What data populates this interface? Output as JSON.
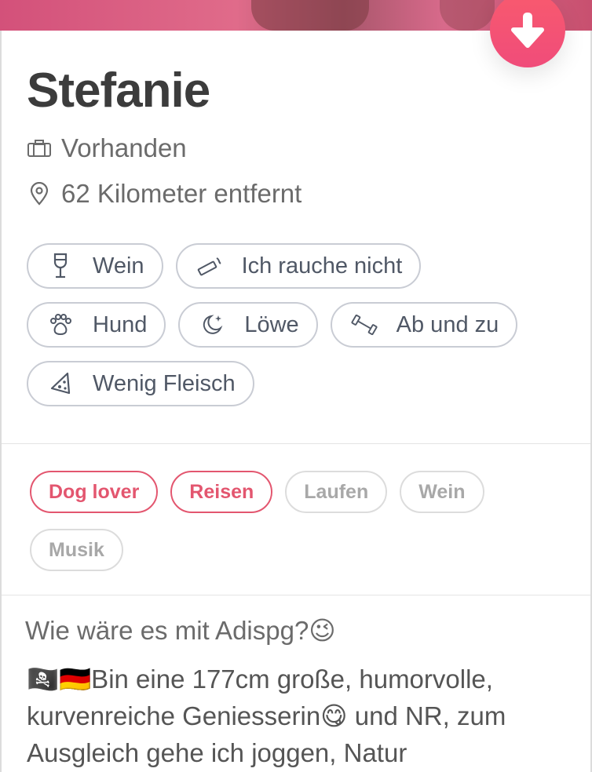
{
  "profile": {
    "name": "Stefanie",
    "job": "Vorhanden",
    "distance": "62 Kilometer entfernt"
  },
  "lifestyle": [
    {
      "icon": "wine-glass-icon",
      "label": "Wein"
    },
    {
      "icon": "cigarette-icon",
      "label": "Ich rauche nicht"
    },
    {
      "icon": "paw-icon",
      "label": "Hund"
    },
    {
      "icon": "moon-star-icon",
      "label": "Löwe"
    },
    {
      "icon": "dumbbell-icon",
      "label": "Ab und zu"
    },
    {
      "icon": "pizza-slice-icon",
      "label": "Wenig Fleisch"
    }
  ],
  "passions": [
    {
      "label": "Dog lover",
      "shared": true
    },
    {
      "label": "Reisen",
      "shared": true
    },
    {
      "label": "Laufen",
      "shared": false
    },
    {
      "label": "Wein",
      "shared": false
    },
    {
      "label": "Musik",
      "shared": false
    }
  ],
  "bio": {
    "title": "Wie wäre es mit Adispg?😉",
    "text": "🏴‍☠️🇩🇪Bin eine 177cm große, humorvolle, kurvenreiche Geniesserin😋 und NR, zum Ausgleich gehe ich joggen, Natur"
  },
  "colors": {
    "accent": "#e3566f",
    "fab": "#f5566f"
  }
}
